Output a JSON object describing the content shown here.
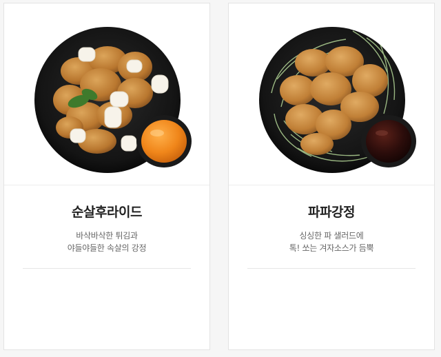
{
  "menu": {
    "items": [
      {
        "name": "순살후라이드",
        "desc_line1": "바삭바삭한 튀김과",
        "desc_line2": "야들야들한 속살의 강정",
        "image": "boneless-fried-chicken-with-rice-cakes-and-orange-sauce"
      },
      {
        "name": "파파강정",
        "desc_line1": "싱싱한 파 샐러드에",
        "desc_line2": "톡! 쏘는 겨자소스가 듬뿍",
        "image": "chicken-gangjeong-on-green-onion-salad-with-dark-sauce"
      }
    ]
  },
  "colors": {
    "card_bg": "#ffffff",
    "page_bg": "#f6f6f6",
    "title": "#222222",
    "desc": "#666666",
    "plate": "#1c1c1c",
    "chicken": "#c98a3e",
    "orange_sauce": "#f08a1e",
    "dark_sauce": "#2a0f0d",
    "scallion": "#9fc28a"
  }
}
